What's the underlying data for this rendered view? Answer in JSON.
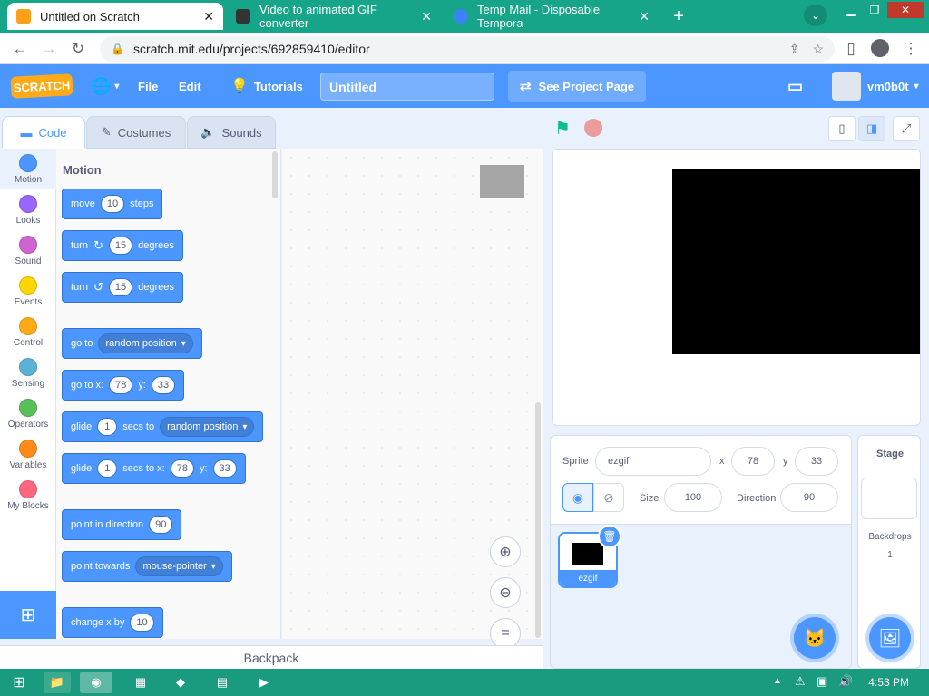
{
  "browser": {
    "tabs": [
      {
        "title": "Untitled on Scratch"
      },
      {
        "title": "Video to animated GIF converter"
      },
      {
        "title": "Temp Mail - Disposable Tempora"
      }
    ],
    "url": "scratch.mit.edu/projects/692859410/editor"
  },
  "menubar": {
    "file": "File",
    "edit": "Edit",
    "tutorials": "Tutorials",
    "project_title": "Untitled",
    "see_project": "See Project Page",
    "username": "vm0b0t"
  },
  "editor_tabs": {
    "code": "Code",
    "costumes": "Costumes",
    "sounds": "Sounds"
  },
  "categories": [
    {
      "label": "Motion",
      "color": "#4c97ff"
    },
    {
      "label": "Looks",
      "color": "#9966ff"
    },
    {
      "label": "Sound",
      "color": "#cf63cf"
    },
    {
      "label": "Events",
      "color": "#ffd500"
    },
    {
      "label": "Control",
      "color": "#ffab19"
    },
    {
      "label": "Sensing",
      "color": "#5cb1d6"
    },
    {
      "label": "Operators",
      "color": "#59c059"
    },
    {
      "label": "Variables",
      "color": "#ff8c1a"
    },
    {
      "label": "My Blocks",
      "color": "#ff6680"
    }
  ],
  "palette": {
    "title": "Motion",
    "move": {
      "a": "move",
      "n": "10",
      "b": "steps"
    },
    "turn_right": {
      "a": "turn",
      "n": "15",
      "b": "degrees"
    },
    "turn_left": {
      "a": "turn",
      "n": "15",
      "b": "degrees"
    },
    "goto": {
      "a": "go to",
      "d": "random position"
    },
    "gotoxy": {
      "a": "go to x:",
      "x": "78",
      "b": "y:",
      "y": "33"
    },
    "glide_to": {
      "a": "glide",
      "n": "1",
      "b": "secs to",
      "d": "random position"
    },
    "glide_xy": {
      "a": "glide",
      "n": "1",
      "b": "secs to x:",
      "x": "78",
      "c": "y:",
      "y": "33"
    },
    "point_dir": {
      "a": "point in direction",
      "n": "90"
    },
    "point_towards": {
      "a": "point towards",
      "d": "mouse-pointer"
    },
    "change_x": {
      "a": "change x by",
      "n": "10"
    }
  },
  "backpack": "Backpack",
  "sprite_info": {
    "sprite_label": "Sprite",
    "sprite_name": "ezgif",
    "x_label": "x",
    "x": "78",
    "y_label": "y",
    "y": "33",
    "size_label": "Size",
    "size": "100",
    "direction_label": "Direction",
    "direction": "90"
  },
  "sprites": [
    {
      "name": "ezgif"
    }
  ],
  "stage_panel": {
    "title": "Stage",
    "backdrops_label": "Backdrops",
    "backdrops_count": "1"
  },
  "taskbar": {
    "time": "4:53 PM"
  }
}
